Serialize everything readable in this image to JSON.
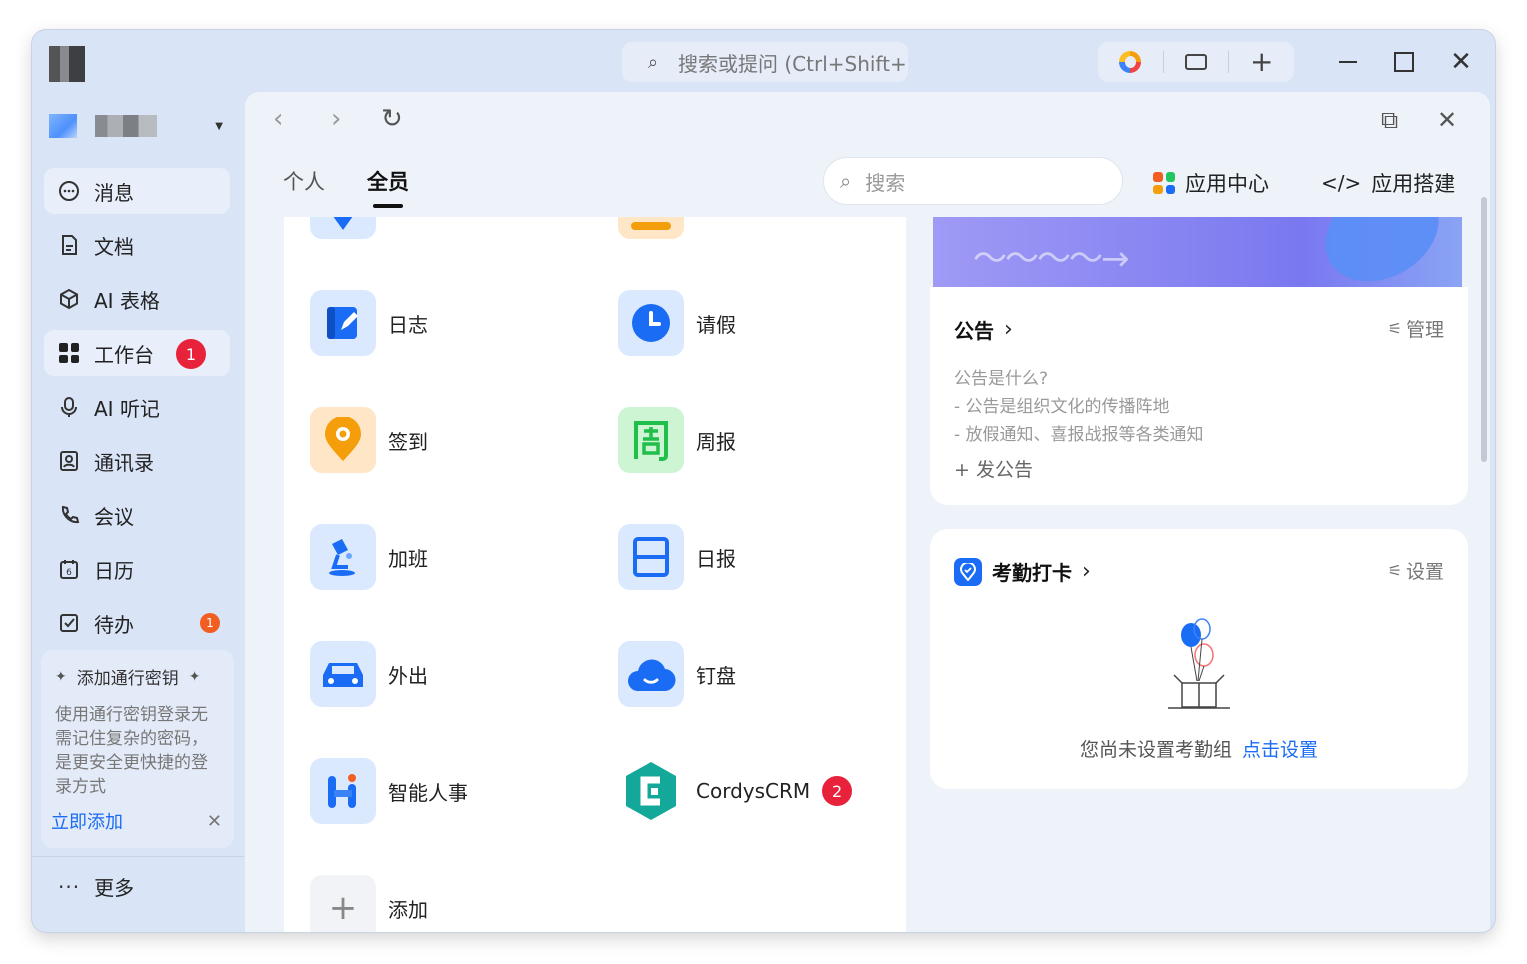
{
  "titlebar": {
    "search_placeholder": "搜索或提问 (Ctrl+Shift+",
    "icons": [
      "ai-search-icon",
      "colorful-spin-icon",
      "screen-cast-icon",
      "plus-icon",
      "minimize-icon",
      "maximize-icon",
      "close-icon"
    ]
  },
  "sidebar": {
    "items": [
      {
        "label": "消息",
        "icon": "chat-bubble-icon",
        "active": false
      },
      {
        "label": "文档",
        "icon": "document-icon",
        "active": false
      },
      {
        "label": "AI 表格",
        "icon": "cube-icon",
        "active": false
      },
      {
        "label": "工作台",
        "icon": "grid-icon",
        "active": true,
        "badge": "1"
      },
      {
        "label": "AI 听记",
        "icon": "microphone-icon",
        "active": false
      },
      {
        "label": "通讯录",
        "icon": "contacts-icon",
        "active": false
      },
      {
        "label": "会议",
        "icon": "phone-icon",
        "active": false
      },
      {
        "label": "日历",
        "icon": "calendar-icon",
        "active": false
      },
      {
        "label": "待办",
        "icon": "checkbox-icon",
        "active": false,
        "badge": "1"
      }
    ],
    "passkey": {
      "title": "添加通行密钥",
      "desc": "使用通行密钥登录无需记住复杂的密码，是更安全更快捷的登录方式",
      "action": "立即添加"
    },
    "more_label": "更多"
  },
  "main": {
    "tabs": [
      "个人",
      "全员"
    ],
    "active_tab": "全员",
    "search_placeholder": "搜索",
    "app_center_label": "应用中心",
    "app_builder_label": "应用搭建",
    "apps": [
      {
        "label": "日志",
        "icon": "journal-icon"
      },
      {
        "label": "请假",
        "icon": "clock-icon"
      },
      {
        "label": "签到",
        "icon": "location-pin-icon"
      },
      {
        "label": "周报",
        "icon": "weekly-report-icon"
      },
      {
        "label": "加班",
        "icon": "desk-lamp-icon"
      },
      {
        "label": "日报",
        "icon": "daily-report-icon"
      },
      {
        "label": "外出",
        "icon": "car-icon"
      },
      {
        "label": "钉盘",
        "icon": "cloud-icon"
      },
      {
        "label": "智能人事",
        "icon": "hr-icon"
      },
      {
        "label": "CordysCRM",
        "icon": "crm-icon",
        "badge": "2"
      },
      {
        "label": "添加",
        "icon": "plus-icon"
      }
    ],
    "announcement": {
      "title": "公告",
      "action": "管理",
      "lines": [
        "公告是什么?",
        "- 公告是组织文化的传播阵地",
        "- 放假通知、喜报战报等各类通知"
      ],
      "add_label": "发公告"
    },
    "attendance": {
      "title": "考勤打卡",
      "action": "设置",
      "empty_text": "您尚未设置考勤组",
      "empty_link": "点击设置"
    }
  },
  "colors": {
    "accent": "#1a6cf5",
    "badge_red": "#e8223a",
    "badge_orange": "#f25d22"
  }
}
